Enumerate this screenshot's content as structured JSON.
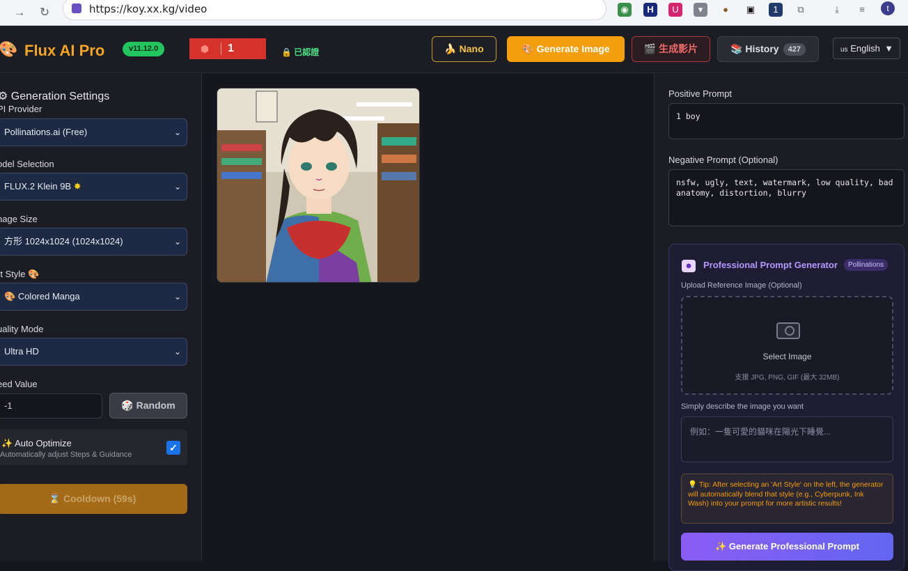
{
  "browser": {
    "url": "https://koy.xx.kg/video",
    "back_icon": "back-arrow-icon",
    "forward_icon": "forward-arrow-icon",
    "reload_icon": "reload-icon",
    "ext_badge": "1",
    "profile_initial": "t"
  },
  "header": {
    "logo_text": "Flux AI Pro",
    "version": "v11.12.0",
    "counter_value": "1",
    "verified_label": "已認證",
    "nano_label": "Nano",
    "generate_label": "Generate Image",
    "video_label": "生成影片",
    "history_label": "History",
    "history_count": "427",
    "language": "English",
    "language_prefix": "us"
  },
  "left": {
    "title": "Generation Settings",
    "api_label": "PI Provider",
    "api_value": "Pollinations.ai (Free)",
    "model_label": "odel Selection",
    "model_value": "FLUX.2 Klein 9B",
    "size_label": "nage Size",
    "size_value": "方形 1024x1024 (1024x1024)",
    "style_label": "rt Style",
    "style_value": "Colored Manga",
    "quality_label": "uality Mode",
    "quality_value": "Ultra HD",
    "seed_label": "eed Value",
    "seed_value": "-1",
    "random_label": "Random",
    "auto_title": "Auto Optimize",
    "auto_sub": "Automatically adjust Steps & Guidance",
    "auto_checked": true,
    "cooldown_label": "Cooldown (59s)"
  },
  "right": {
    "positive_label": "Positive Prompt",
    "positive_value": "1 boy",
    "negative_label": "Negative Prompt (Optional)",
    "negative_value": "nsfw, ugly, text, watermark, low quality, bad anatomy, distortion, blurry",
    "ppg_title": "Professional Prompt Generator",
    "ppg_badge": "Pollinations",
    "upload_label": "Upload Reference Image (Optional)",
    "upload_title": "Select Image",
    "upload_sub": "支援 JPG, PNG, GIF (最大 32MB)",
    "describe_label": "Simply describe the image you want",
    "describe_placeholder": "例如：一隻可愛的貓咪在陽光下睡覺...",
    "tip": "Tip: After selecting an 'Art Style' on the left, the generator will automatically blend that style (e.g., Cyberpunk, Ink Wash) into your prompt for more artistic results!",
    "ppg_button": "Generate Professional Prompt"
  },
  "colors": {
    "accent_orange": "#f59e0b",
    "accent_purple": "#8b5cf6",
    "success_green": "#22c55e",
    "danger_red": "#d7312b"
  }
}
